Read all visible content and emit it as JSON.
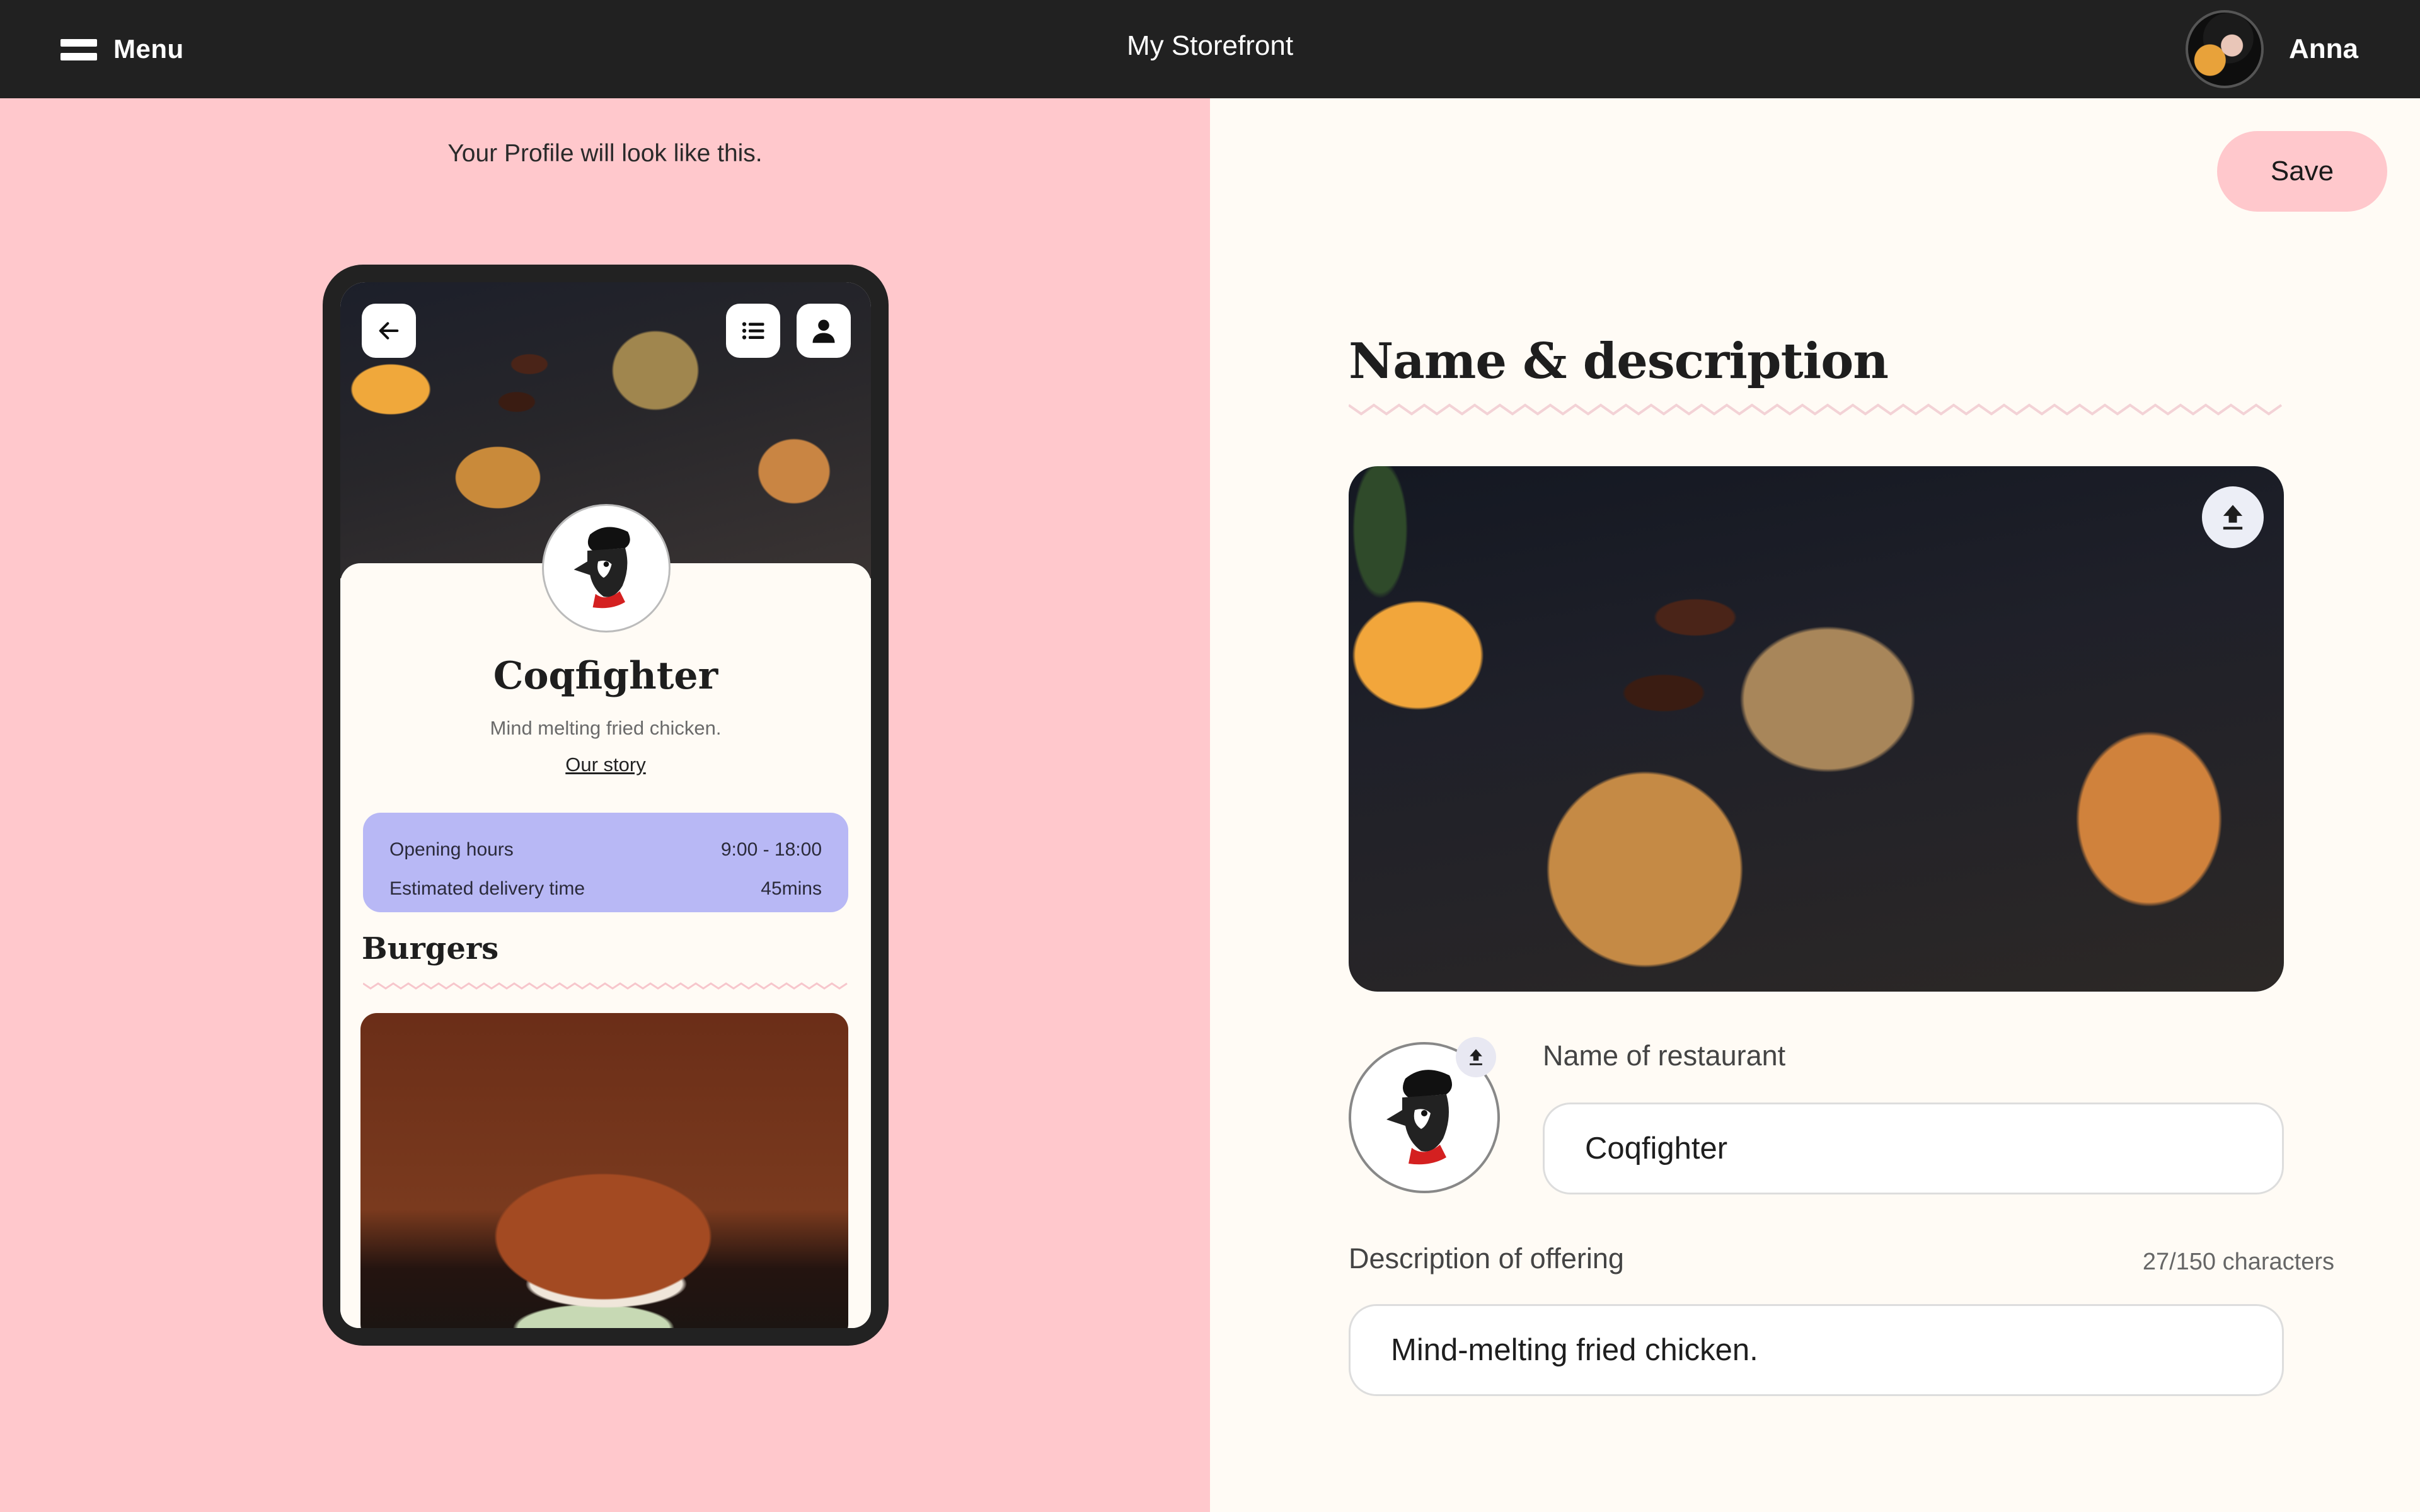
{
  "header": {
    "menu_label": "Menu",
    "menu_icon": "hamburger-icon",
    "title": "My Storefront",
    "user_name": "Anna",
    "avatar_icon": "user-avatar"
  },
  "preview": {
    "caption": "Your Profile will look like this.",
    "nav_icons": [
      "arrow-left-icon",
      "list-icon",
      "user-icon"
    ],
    "restaurant_name": "Coqfighter",
    "tagline": "Mind melting fried chicken.",
    "story_link": "Our story",
    "info": [
      {
        "label": "Opening hours",
        "value": "9:00 - 18:00"
      },
      {
        "label": "Estimated delivery time",
        "value": "45mins"
      }
    ],
    "section_title": "Burgers"
  },
  "editor": {
    "save_label": "Save",
    "section_title": "Name & description",
    "upload_icon": "upload-icon",
    "name_label": "Name of restaurant",
    "name_value": "Coqfighter",
    "desc_label": "Description of offering",
    "char_count": "27/150 characters",
    "desc_value": "Mind-melting fried chicken."
  },
  "colors": {
    "topbar": "#212121",
    "preview_bg": "#ffc8cc",
    "editor_bg": "#fffbf5",
    "accent_pink": "#ffc8cc",
    "info_box": "#b8b8f5"
  }
}
